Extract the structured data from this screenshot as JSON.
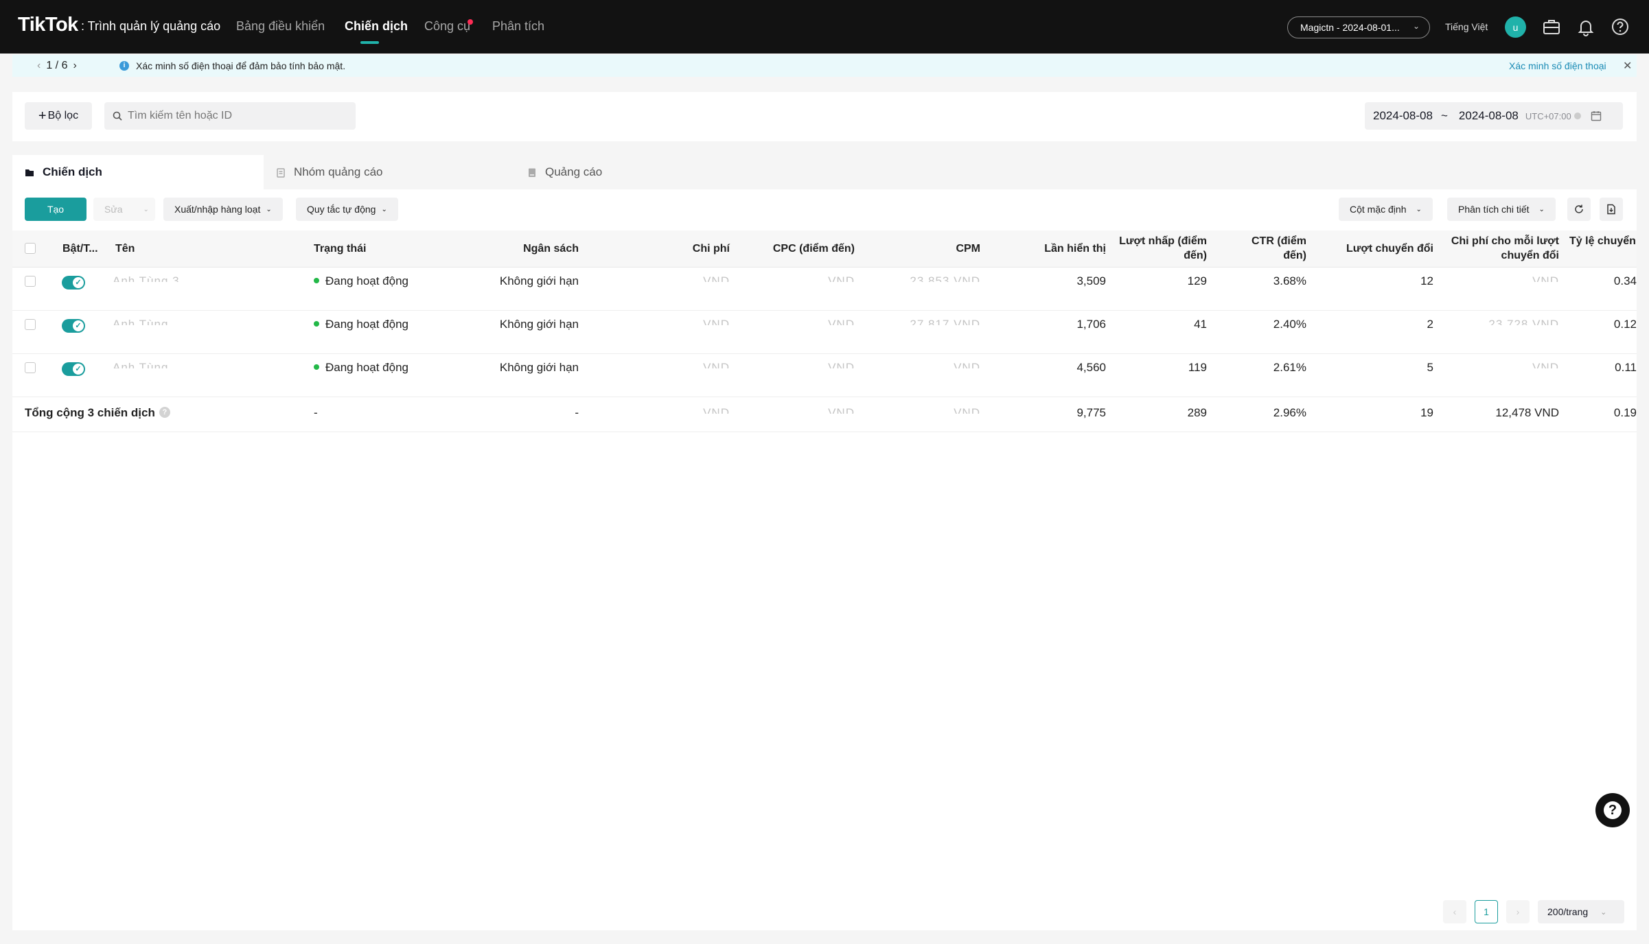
{
  "topnav": {
    "logo": "TikTok",
    "logo_sub": ": Trình quản lý quảng cáo",
    "items": [
      {
        "label": "Bảng điều khiển"
      },
      {
        "label": "Chiến dịch"
      },
      {
        "label": "Công cụ"
      },
      {
        "label": "Phân tích"
      }
    ],
    "account": "Magictn - 2024-08-01...",
    "language": "Tiếng Việt",
    "avatar_letter": "u"
  },
  "notice": {
    "page": "1 / 6",
    "message": "Xác minh số điện thoại để đảm bảo tính bảo mật.",
    "action": "Xác minh số điện thoại"
  },
  "filterbar": {
    "filter_label": "Bộ lọc",
    "search_placeholder": "Tìm kiếm tên hoặc ID",
    "date_start": "2024-08-08",
    "date_sep": "~",
    "date_end": "2024-08-08",
    "timezone": "UTC+07:00"
  },
  "tabs": [
    {
      "label": "Chiến dịch"
    },
    {
      "label": "Nhóm quảng cáo"
    },
    {
      "label": "Quảng cáo"
    }
  ],
  "toolbar": {
    "create": "Tạo",
    "edit": "Sửa",
    "bulk": "Xuất/nhập hàng loạt",
    "rules": "Quy tắc tự động",
    "columns": "Cột mặc định",
    "breakdown": "Phân tích chi tiết"
  },
  "table": {
    "headers": {
      "toggle": "Bật/T...",
      "name": "Tên",
      "status": "Trạng thái",
      "budget": "Ngân sách",
      "cost": "Chi phí",
      "cpc": "CPC (điểm đến)",
      "cpm": "CPM",
      "impressions": "Lần hiển thị",
      "clicks": "Lượt nhấp (điểm đến)",
      "ctr": "CTR (điểm đến)",
      "conversions": "Lượt chuyển đổi",
      "cost_per_conv": "Chi phí cho mỗi lượt chuyển đổi",
      "cvr": "Tỷ lệ chuyển đổi (CVR)"
    },
    "rows": [
      {
        "name": "Anh Tùng 3",
        "status": "Đang hoạt động",
        "budget": "Không giới hạn",
        "cost": "VND",
        "cpc": "VND",
        "cpm": "23,853 VND",
        "impressions": "3,509",
        "clicks": "129",
        "ctr": "3.68%",
        "conversions": "12",
        "cost_per_conv": "VND",
        "cvr": "0.34"
      },
      {
        "name": "Anh Tùng",
        "status": "Đang hoạt động",
        "budget": "Không giới hạn",
        "cost": "VND",
        "cpc": "VND",
        "cpm": "27,817 VND",
        "impressions": "1,706",
        "clicks": "41",
        "ctr": "2.40%",
        "conversions": "2",
        "cost_per_conv": "23,728 VND",
        "cvr": "0.12"
      },
      {
        "name": "Anh Tùng",
        "status": "Đang hoạt động",
        "budget": "Không giới hạn",
        "cost": "VND",
        "cpc": "VND",
        "cpm": "VND",
        "impressions": "4,560",
        "clicks": "119",
        "ctr": "2.61%",
        "conversions": "5",
        "cost_per_conv": "VND",
        "cvr": "0.11"
      }
    ],
    "total": {
      "label": "Tổng cộng 3 chiến dịch",
      "status": "-",
      "budget": "-",
      "cost": "VND",
      "cpc": "VND",
      "cpm": "VND",
      "impressions": "9,775",
      "clicks": "289",
      "ctr": "2.96%",
      "conversions": "19",
      "cost_per_conv": "12,478 VND",
      "cvr": "0.19"
    }
  },
  "pagination": {
    "current": "1",
    "page_size": "200/trang"
  },
  "colors": {
    "accent": "#1a9d9d",
    "nav_bg": "#121212",
    "status_active": "#23b848",
    "notice_bg": "#eaf9fb"
  }
}
